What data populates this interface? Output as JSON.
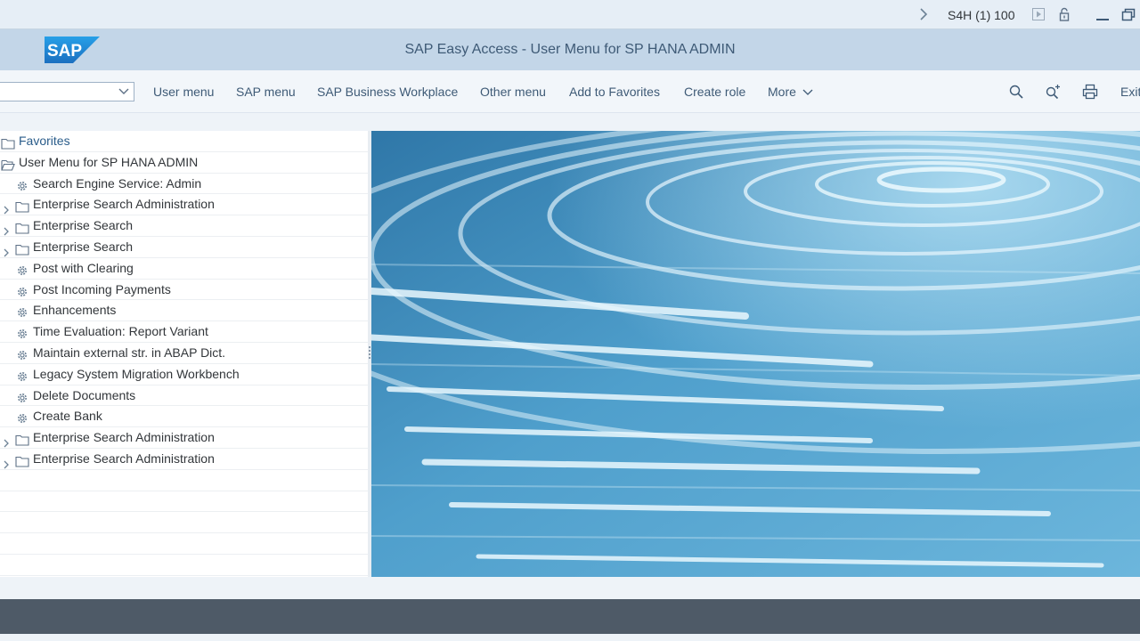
{
  "topbar": {
    "system_info": "S4H (1) 100"
  },
  "window": {
    "title": "SAP Easy Access  -  User Menu for SP HANA ADMIN",
    "logo_text": "SAP"
  },
  "toolbar": {
    "transaction_field_value": "",
    "buttons": [
      "User menu",
      "SAP menu",
      "SAP Business Workplace",
      "Other menu",
      "Add to Favorites",
      "Create role",
      "More"
    ],
    "exit_label": "Exit"
  },
  "tree": {
    "favorites": "Favorites",
    "root": "User Menu for SP HANA ADMIN",
    "items": [
      {
        "label": "Search Engine Service: Admin",
        "kind": "transaction"
      },
      {
        "label": "Enterprise Search Administration",
        "kind": "folder"
      },
      {
        "label": "Enterprise Search",
        "kind": "folder"
      },
      {
        "label": "Enterprise Search",
        "kind": "folder"
      },
      {
        "label": "Post with Clearing",
        "kind": "transaction"
      },
      {
        "label": "Post Incoming Payments",
        "kind": "transaction"
      },
      {
        "label": "Enhancements",
        "kind": "transaction"
      },
      {
        "label": "Time Evaluation: Report Variant",
        "kind": "transaction"
      },
      {
        "label": "Maintain external str. in ABAP Dict.",
        "kind": "transaction"
      },
      {
        "label": "Legacy System Migration Workbench",
        "kind": "transaction"
      },
      {
        "label": "Delete Documents",
        "kind": "transaction"
      },
      {
        "label": "Create Bank",
        "kind": "transaction"
      },
      {
        "label": "Enterprise Search Administration",
        "kind": "folder"
      },
      {
        "label": "Enterprise Search Administration",
        "kind": "folder"
      }
    ]
  },
  "icons": {
    "nav_next": "chevron-right-icon",
    "play": "play-icon",
    "lock": "lock-icon",
    "minimize": "minimize-icon",
    "restore": "restore-icon",
    "search": "search-icon",
    "find_next": "search-plus-icon",
    "print": "printer-icon"
  },
  "colors": {
    "title_bar": "#c3d6e8",
    "footer": "#4e5a67",
    "link_text": "#3e5a76",
    "sap_blue": "#1d7fd0"
  }
}
